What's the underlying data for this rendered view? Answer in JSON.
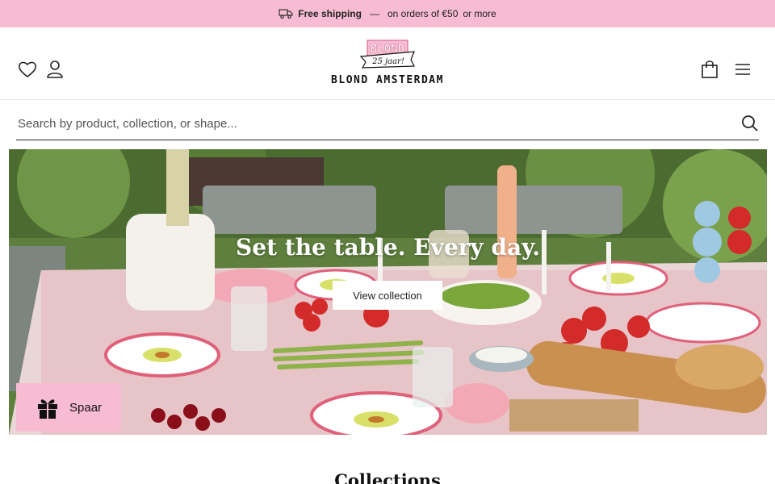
{
  "announcement": {
    "bold": "Free shipping",
    "separator": "—",
    "text": "on orders of €50",
    "suffix": "or more",
    "bg_color": "#f7bcd2"
  },
  "header": {
    "logo_text": "BLOND AMSTERDAM",
    "logo_badge_top": "BLOND",
    "logo_badge_ribbon": "25 jaar!",
    "icons": [
      "heart-icon",
      "user-icon",
      "shopping-bag-icon",
      "hamburger-menu-icon"
    ]
  },
  "search": {
    "placeholder": "Search by product, collection, or shape..."
  },
  "hero": {
    "title": "Set the table. Every day.",
    "button_label": "View collection"
  },
  "rewards": {
    "label": "Spaar",
    "icon": "gift-icon"
  },
  "collections": {
    "title": "Collections"
  }
}
